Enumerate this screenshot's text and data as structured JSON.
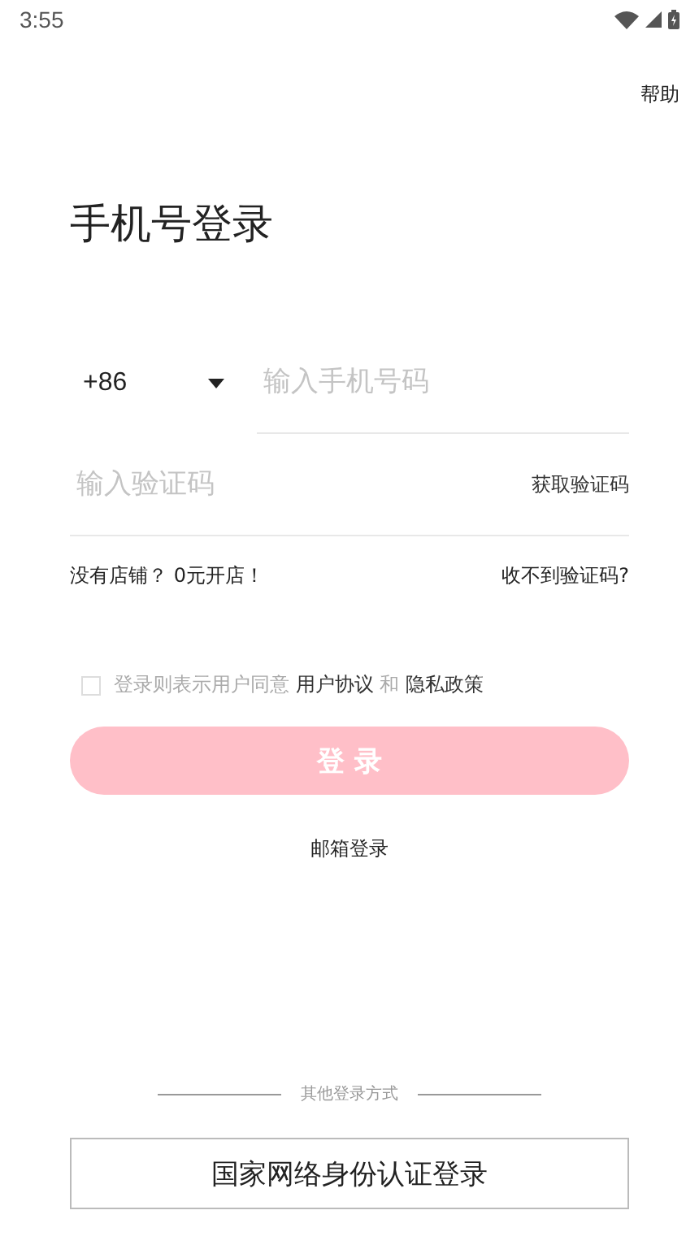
{
  "status_bar": {
    "time": "3:55"
  },
  "help": "帮助",
  "title": "手机号登录",
  "phone": {
    "country_code": "+86",
    "placeholder": "输入手机号码"
  },
  "code": {
    "placeholder": "输入验证码",
    "action": "获取验证码"
  },
  "links": {
    "left": "没有店铺？ 0元开店！",
    "right": "收不到验证码?"
  },
  "agreement": {
    "checked": false,
    "prefix": "登录则表示用户同意",
    "terms": "用户协议",
    "joiner": "和",
    "privacy": "隐私政策"
  },
  "login_button": {
    "label": "登 录",
    "disabled": true
  },
  "email_login": "邮箱登录",
  "other_label": "其他登录方式",
  "national_button": "国家网络身份认证登录"
}
